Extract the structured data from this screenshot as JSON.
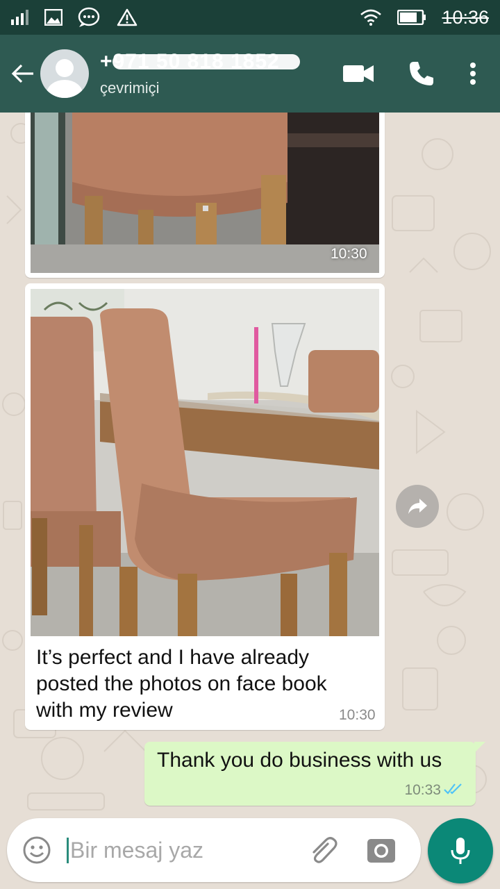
{
  "status_bar": {
    "time": "10:36"
  },
  "header": {
    "back_icon": "arrow-left-icon",
    "contact_name": "+971 50 818 1852",
    "contact_status": "çevrimiçi",
    "icons": [
      "video-call-icon",
      "phone-icon",
      "more-vert-icon"
    ]
  },
  "messages": [
    {
      "type": "image",
      "direction": "incoming",
      "time": "10:30"
    },
    {
      "type": "image",
      "direction": "incoming",
      "caption": "It’s perfect and I have already posted the photos on face book with my review",
      "time": "10:30"
    },
    {
      "type": "text",
      "direction": "outgoing",
      "text": "Thank you do business with us",
      "time": "10:33",
      "status": "read"
    }
  ],
  "input": {
    "placeholder": "Bir mesaj yaz"
  },
  "colors": {
    "header": "#2e5a52",
    "status_bar": "#1b4038",
    "outgoing_bubble": "#dcf8c6",
    "mic_button": "#0b8877",
    "read_ticks": "#4fc3f7"
  }
}
